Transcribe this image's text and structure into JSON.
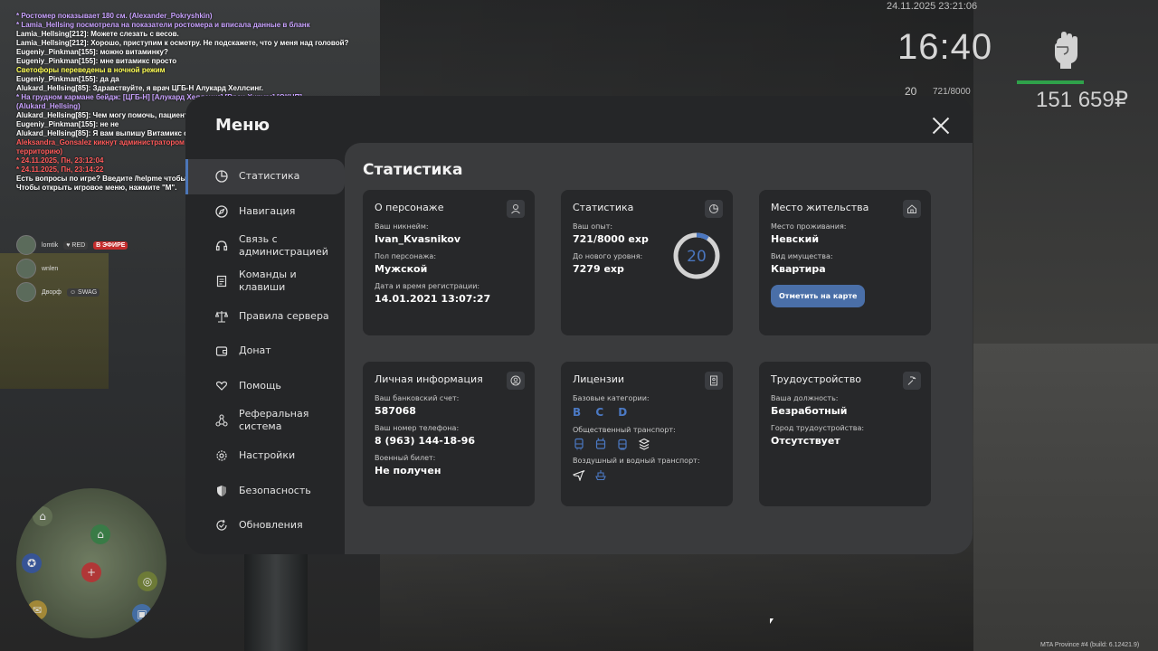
{
  "chat": [
    {
      "text": " * Ростомер показывает 180 см. (Alexander_Pokryshkin)",
      "color": "purple"
    },
    {
      "text": " * Lamia_Hellsing посмотрела на показатели ростомера и вписала данные в бланк",
      "color": "purple"
    },
    {
      "text": "Lamia_Hellsing[212]: Можете слезать с весов.",
      "color": "white"
    },
    {
      "text": "Lamia_Hellsing[212]: Хорошо, приступим к осмотру. Не подскажете, что у меня над головой?",
      "color": "white"
    },
    {
      "text": "Eugeniy_Pinkman[155]: можно витаминку?",
      "color": "white"
    },
    {
      "text": "Eugeniy_Pinkman[155]: мне витамикс просто",
      "color": "white"
    },
    {
      "text": "Светофоры переведены в ночной режим",
      "color": "yellow"
    },
    {
      "text": "Eugeniy_Pinkman[155]: да да",
      "color": "white"
    },
    {
      "text": "Alukard_Hellsing[85]: Здравствуйте, я врач ЦГБ-Н Алукард Хеллсинг.",
      "color": "white"
    },
    {
      "text": " * На грудном кармане бейдж: [ЦГБ-Н] [Алукард Хеллсинг] [Врач-Хирург] [ОКНП]. (Alukard_Hellsing)",
      "color": "purple"
    },
    {
      "text": "Alukard_Hellsing[85]: Чем могу помочь, пациент?",
      "color": "white"
    },
    {
      "text": "Eugeniy_Pinkman[155]: не не",
      "color": "white"
    },
    {
      "text": "Alukard_Hellsing[85]: Я вам выпишу Витамикс стоимостью 500р. Вы согласны?",
      "color": "white"
    },
    {
      "text": "Aleksandra_Gonsalez кикнут администратором Vasiliy_Iverskoy (Пропуски: на закрыщую территорию)",
      "color": "red"
    },
    {
      "text": " * 24.11.2025, Пн, 23:12:04",
      "color": "red"
    },
    {
      "text": " * 24.11.2025, Пн, 23:14:22",
      "color": "red"
    },
    {
      "text": "Есть вопросы по игре? Введите /helpme чтобы получить нужную информацию.",
      "color": "white"
    },
    {
      "text": "Чтобы открыть игровое меню, нажмите \"M\".",
      "color": "white"
    }
  ],
  "hud": {
    "datetime": "24.11.2025 23:21:06",
    "time": "16:40",
    "level": "20",
    "exp": "721/8000",
    "money": "151 659₽",
    "fist_icon": "fist-icon"
  },
  "voice": [
    {
      "name": "lomtik",
      "badge": "RED",
      "live": "В ЭФИРЕ"
    },
    {
      "name": "wnlen",
      "badge": "",
      "live": ""
    },
    {
      "name": "Дворф",
      "badge": "SWAG",
      "live": ""
    }
  ],
  "menu": {
    "title": "Меню",
    "sidebar": [
      {
        "label": "Статистика",
        "icon": "stats-icon"
      },
      {
        "label": "Навигация",
        "icon": "compass-icon"
      },
      {
        "label": "Связь с администрацией",
        "icon": "headset-icon"
      },
      {
        "label": "Команды и клавиши",
        "icon": "document-icon"
      },
      {
        "label": "Правила сервера",
        "icon": "scales-icon"
      },
      {
        "label": "Донат",
        "icon": "wallet-icon"
      },
      {
        "label": "Помощь",
        "icon": "heart-hands-icon"
      },
      {
        "label": "Реферальная система",
        "icon": "network-icon"
      },
      {
        "label": "Настройки",
        "icon": "gear-icon"
      },
      {
        "label": "Безопасность",
        "icon": "shield-icon"
      },
      {
        "label": "Обновления",
        "icon": "refresh-icon"
      }
    ],
    "content_title": "Статистика",
    "cards": {
      "person": {
        "title": "О персонаже",
        "nick_label": "Ваш никнейм:",
        "nick": "Ivan_Kvasnikov",
        "gender_label": "Пол персонажа:",
        "gender": "Мужской",
        "reg_label": "Дата и время регистрации:",
        "reg": "14.01.2021 13:07:27"
      },
      "stats": {
        "title": "Статистика",
        "exp_label": "Ваш опыт:",
        "exp": "721/8000 exp",
        "next_label": "До нового уровня:",
        "next": "7279 exp",
        "level": "20",
        "progress": 0.09
      },
      "residence": {
        "title": "Место жительства",
        "place_label": "Место проживания:",
        "place": "Невский",
        "type_label": "Вид имущества:",
        "type": "Квартира",
        "button": "Отметить на карте"
      },
      "personal": {
        "title": "Личная информация",
        "bank_label": "Ваш банковский счет:",
        "bank": "587068",
        "phone_label": "Ваш номер телефона:",
        "phone": "8 (963) 144-18-96",
        "military_label": "Военный билет:",
        "military": "Не получен"
      },
      "licenses": {
        "title": "Лицензии",
        "base_label": "Базовые категории:",
        "base": "B C D",
        "public_label": "Общественный транспорт:",
        "air_label": "Воздушный и водный транспорт:"
      },
      "job": {
        "title": "Трудоустройство",
        "position_label": "Ваша должность:",
        "position": "Безработный",
        "city_label": "Город трудоустройства:",
        "city": "Отсутствует"
      }
    }
  },
  "footer": "MTA Province #4 (build: 6.12421.9)"
}
